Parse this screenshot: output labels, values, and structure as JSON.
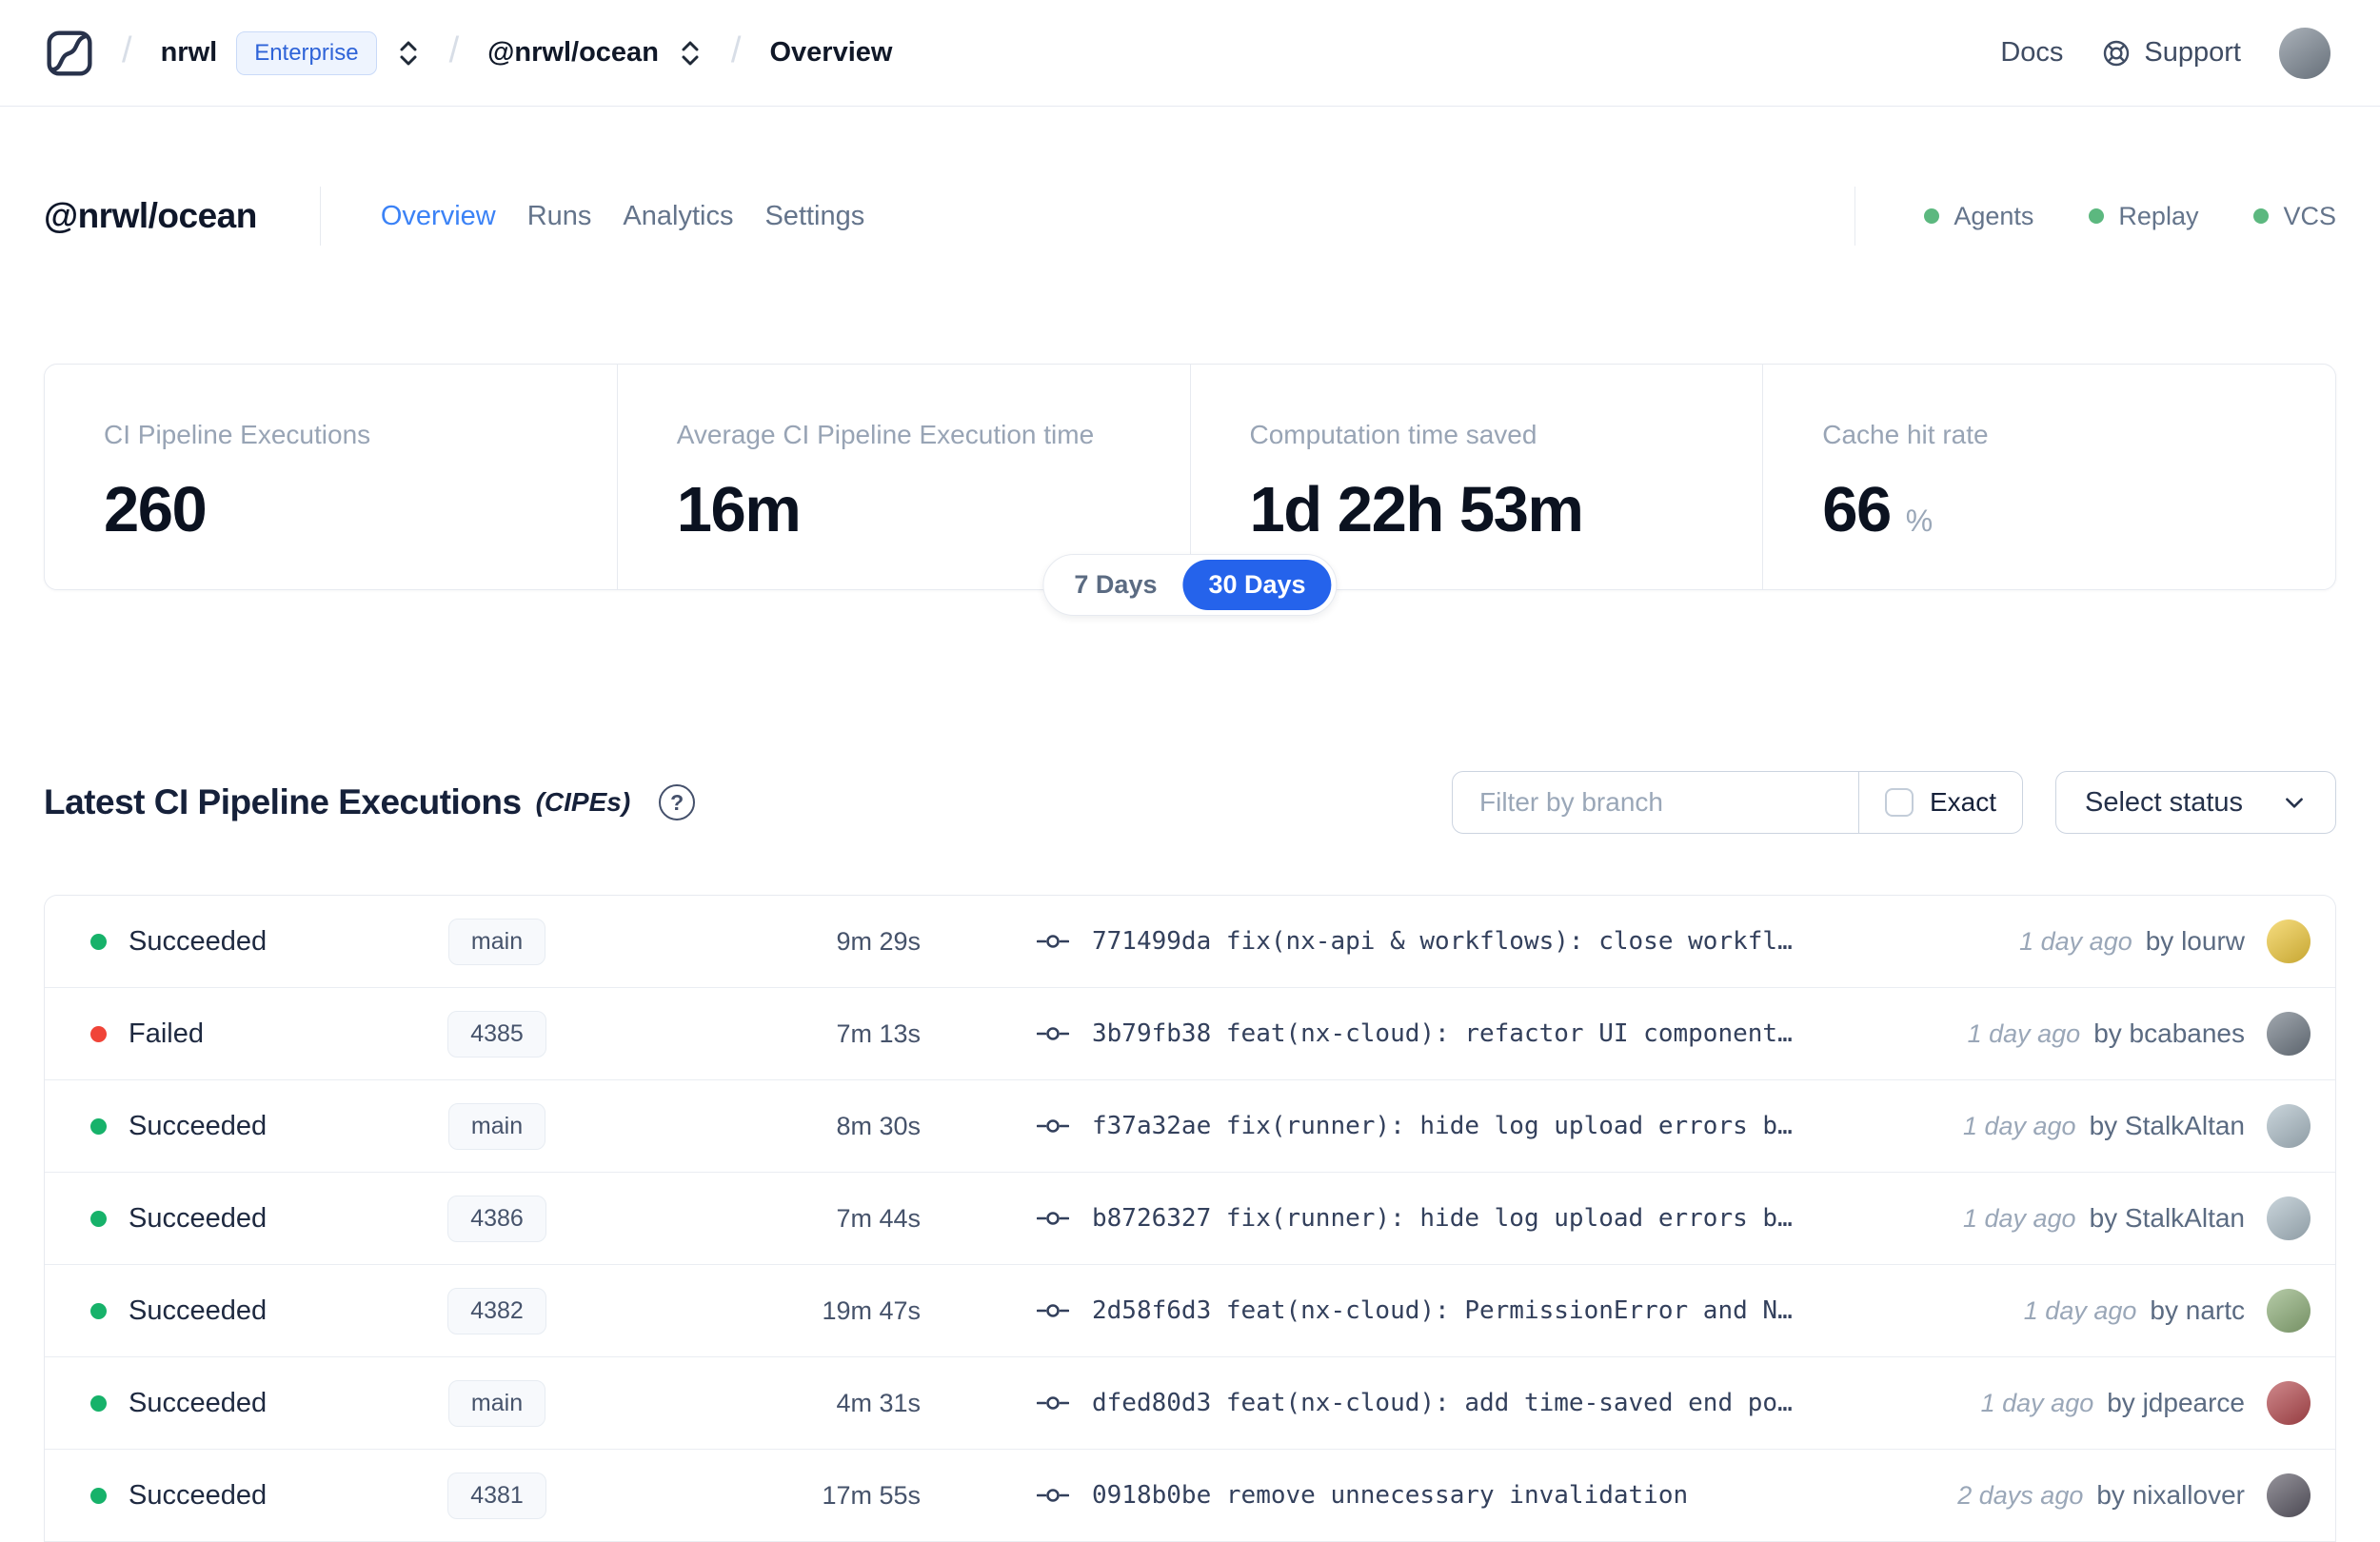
{
  "navbar": {
    "breadcrumb": {
      "separator": "/",
      "org": "nrwl",
      "org_badge": "Enterprise",
      "workspace": "@nrwl/ocean",
      "page": "Overview"
    },
    "docs_label": "Docs",
    "support_label": "Support",
    "avatar_color": "#7d8894"
  },
  "workspace_header": {
    "title": "@nrwl/ocean",
    "tabs": [
      {
        "label": "Overview",
        "active": true
      },
      {
        "label": "Runs",
        "active": false
      },
      {
        "label": "Analytics",
        "active": false
      },
      {
        "label": "Settings",
        "active": false
      }
    ],
    "status_indicators": [
      {
        "label": "Agents",
        "color": "#5cb87f"
      },
      {
        "label": "Replay",
        "color": "#5cb87f"
      },
      {
        "label": "VCS",
        "color": "#5cb87f"
      }
    ]
  },
  "stats": {
    "cards": [
      {
        "label": "CI Pipeline Executions",
        "value": "260",
        "suffix": ""
      },
      {
        "label": "Average CI Pipeline Execution time",
        "value": "16m",
        "suffix": ""
      },
      {
        "label": "Computation time saved",
        "value": "1d 22h 53m",
        "suffix": ""
      },
      {
        "label": "Cache hit rate",
        "value": "66",
        "suffix": "%"
      }
    ],
    "range_toggle": {
      "options": [
        "7 Days",
        "30 Days"
      ],
      "selected": "30 Days"
    }
  },
  "cipe_section": {
    "title": "Latest CI Pipeline Executions",
    "title_note": "(CIPEs)",
    "help_icon": "?",
    "filter_placeholder": "Filter by branch",
    "filter_value": "",
    "exact_label": "Exact",
    "exact_checked": false,
    "status_select_label": "Select status",
    "rows": [
      {
        "status": "Succeeded",
        "status_key": "succeeded",
        "branch": "main",
        "duration": "9m 29s",
        "commit_hash": "771499da",
        "commit_message": "fix(nx-api & workflows): close workfl…",
        "time_ago": "1 day ago",
        "author": "by lourw",
        "avatar_color": "#f2cb3d"
      },
      {
        "status": "Failed",
        "status_key": "failed",
        "branch": "4385",
        "duration": "7m 13s",
        "commit_hash": "3b79fb38",
        "commit_message": "feat(nx-cloud): refactor UI component…",
        "time_ago": "1 day ago",
        "author": "by bcabanes",
        "avatar_color": "#707a85"
      },
      {
        "status": "Succeeded",
        "status_key": "succeeded",
        "branch": "main",
        "duration": "8m 30s",
        "commit_hash": "f37a32ae",
        "commit_message": "fix(runner): hide log upload errors b…",
        "time_ago": "1 day ago",
        "author": "by StalkAltan",
        "avatar_color": "#aebfc9"
      },
      {
        "status": "Succeeded",
        "status_key": "succeeded",
        "branch": "4386",
        "duration": "7m 44s",
        "commit_hash": "b8726327",
        "commit_message": "fix(runner): hide log upload errors b…",
        "time_ago": "1 day ago",
        "author": "by StalkAltan",
        "avatar_color": "#aebfc9"
      },
      {
        "status": "Succeeded",
        "status_key": "succeeded",
        "branch": "4382",
        "duration": "19m 47s",
        "commit_hash": "2d58f6d3",
        "commit_message": "feat(nx-cloud): PermissionError and N…",
        "time_ago": "1 day ago",
        "author": "by nartc",
        "avatar_color": "#8fb07a"
      },
      {
        "status": "Succeeded",
        "status_key": "succeeded",
        "branch": "main",
        "duration": "4m 31s",
        "commit_hash": "dfed80d3",
        "commit_message": "feat(nx-cloud): add time-saved end po…",
        "time_ago": "1 day ago",
        "author": "by jdpearce",
        "avatar_color": "#b64a4f"
      },
      {
        "status": "Succeeded",
        "status_key": "succeeded",
        "branch": "4381",
        "duration": "17m 55s",
        "commit_hash": "0918b0be",
        "commit_message": "remove unnecessary invalidation",
        "time_ago": "2 days ago",
        "author": "by nixallover",
        "avatar_color": "#5d5a66"
      }
    ]
  },
  "colors": {
    "accent_blue": "#2563eb",
    "tab_active_blue": "#3b82f6",
    "success_green": "#17b26a",
    "failed_red": "#f04438",
    "indicator_green": "#5cb87f"
  }
}
